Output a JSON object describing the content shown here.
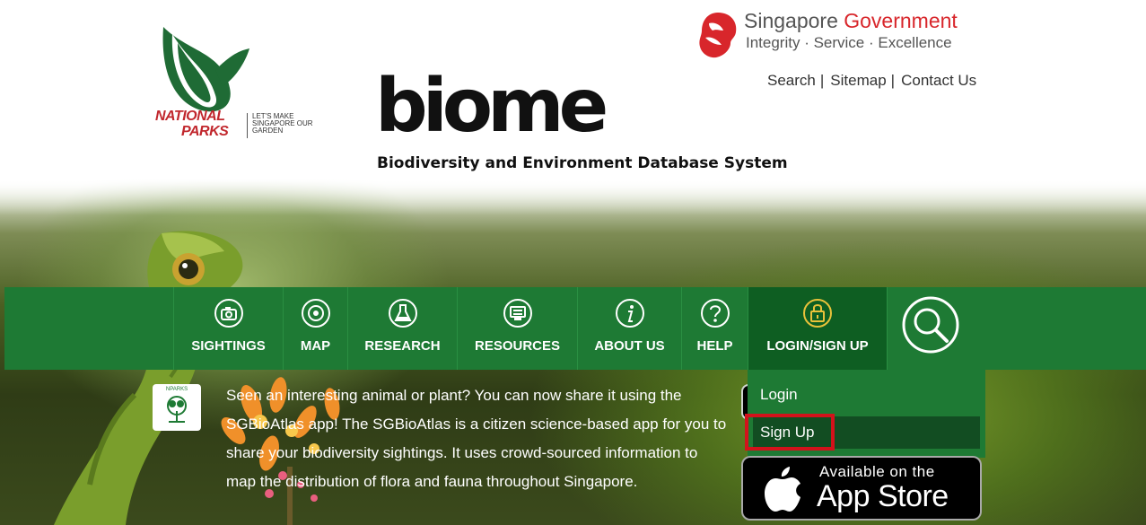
{
  "header": {
    "nparks": {
      "name_line1": "NATIONAL",
      "name_line2": "PARKS",
      "tagline": "LET'S MAKE SINGAPORE OUR GARDEN"
    },
    "biome": {
      "logo_text": "biome",
      "subtitle": "Biodiversity and Environment Database System"
    },
    "sg_gov": {
      "title_part1": "Singapore ",
      "title_part2": "Government",
      "tagline": "Integrity · Service · Excellence"
    },
    "toplinks": {
      "search": "Search",
      "sitemap": "Sitemap",
      "contact": "Contact Us",
      "separator": "|"
    }
  },
  "nav": {
    "items": [
      {
        "label": "SIGHTINGS",
        "icon": "camera-icon"
      },
      {
        "label": "MAP",
        "icon": "map-pin-icon"
      },
      {
        "label": "RESEARCH",
        "icon": "flask-icon"
      },
      {
        "label": "RESOURCES",
        "icon": "computer-icon"
      },
      {
        "label": "ABOUT US",
        "icon": "info-icon"
      },
      {
        "label": "HELP",
        "icon": "question-icon"
      },
      {
        "label": "LOGIN/SIGN UP",
        "icon": "lock-icon"
      }
    ],
    "search_icon": "search-icon"
  },
  "dropdown": {
    "login": "Login",
    "signup": "Sign Up"
  },
  "info": {
    "badge_label": "NPARKS",
    "text": "Seen an interesting animal or plant? You can now share it using the SGBioAtlas app! The SGBioAtlas is a citizen science-based app for you to share your biodiversity sightings. It uses crowd-sourced information to map the distribution of flora and fauna throughout Singapore."
  },
  "appstore": {
    "small": "Available on the",
    "big": "App Store"
  },
  "colors": {
    "nav_green": "#1e7a34",
    "nav_active": "#0e5e22",
    "highlight_red": "#d3121b",
    "sg_red": "#d8262b",
    "icon_yellow": "#e8c23a"
  }
}
